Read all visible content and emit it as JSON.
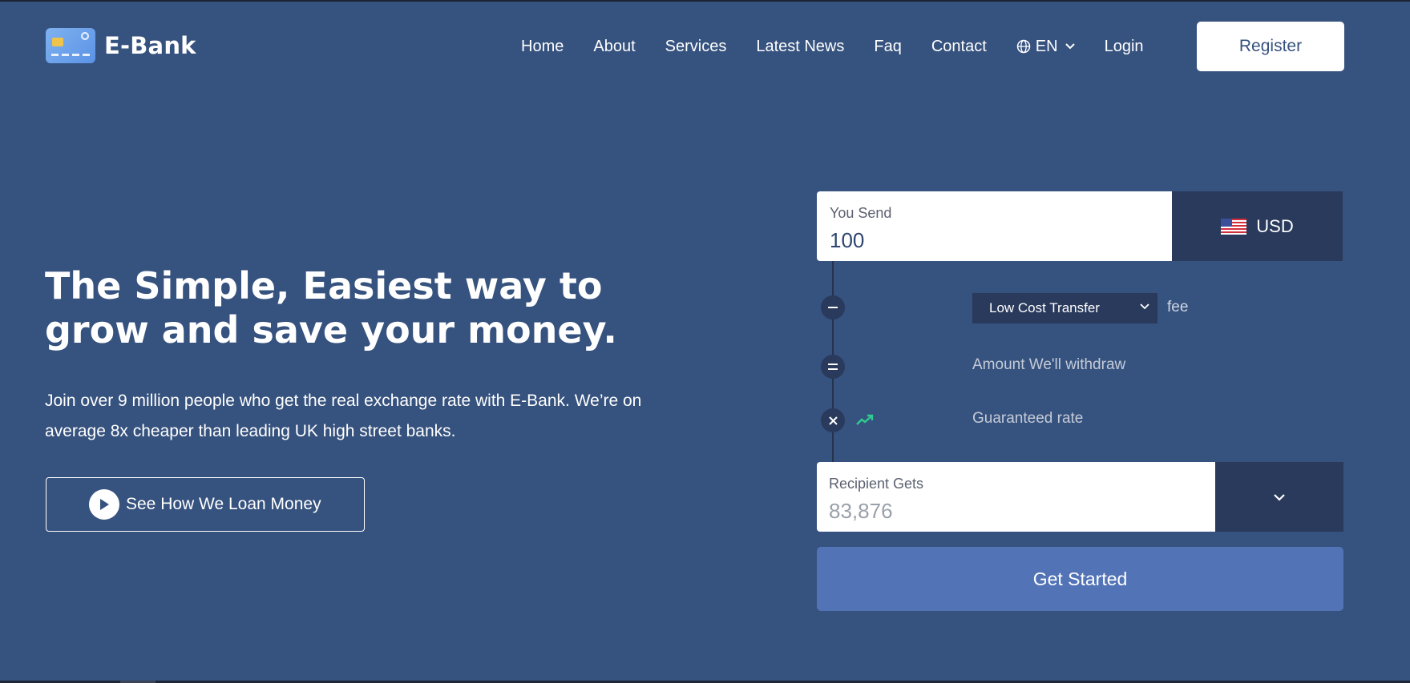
{
  "brand": {
    "name": "E-Bank"
  },
  "nav": {
    "items": [
      "Home",
      "About",
      "Services",
      "Latest News",
      "Faq",
      "Contact"
    ],
    "language": "EN",
    "login": "Login",
    "register": "Register"
  },
  "hero": {
    "title": "The Simple, Easiest way to grow and save your money.",
    "subtitle": "Join over 9 million people who get the real exchange rate with E-Bank. We’re on average 8x cheaper than leading UK high street banks.",
    "video_button": "See How We Loan Money"
  },
  "converter": {
    "send_label": "You Send",
    "send_value": "100",
    "send_currency": "USD",
    "fee_option": "Low Cost Transfer",
    "fee_suffix": "fee",
    "withdraw_label": "Amount We'll withdraw",
    "rate_label": "Guaranteed rate",
    "recipient_label": "Recipient Gets",
    "recipient_value": "83,876",
    "cta": "Get Started"
  },
  "colors": {
    "background": "#36527e",
    "dark_panel": "#293a5c",
    "cta": "#5273b6",
    "trend": "#2ecc8f"
  },
  "icons": {
    "minus": "minus-icon",
    "equals": "equals-icon",
    "times": "times-icon",
    "trend": "trending-up-icon",
    "globe": "globe-icon",
    "play": "play-icon",
    "flag": "us-flag-icon"
  }
}
